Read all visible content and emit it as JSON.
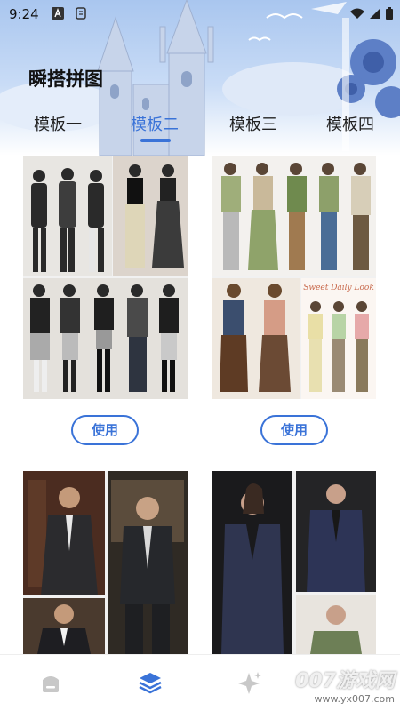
{
  "status_bar": {
    "time": "9:24",
    "icons": [
      "a-badge-icon",
      "app-icon",
      "wifi-icon",
      "signal-icon",
      "battery-icon"
    ]
  },
  "header": {
    "title": "瞬搭拼图"
  },
  "tabs": [
    {
      "label": "模板一",
      "active": false
    },
    {
      "label": "模板二",
      "active": true
    },
    {
      "label": "模板三",
      "active": false
    },
    {
      "label": "模板四",
      "active": false
    }
  ],
  "templates": [
    {
      "name": "street-style",
      "button": "使用"
    },
    {
      "name": "casual-collection",
      "button": "使用",
      "caption": "Sweet Daily Look"
    },
    {
      "name": "menswear-suits",
      "button": ""
    },
    {
      "name": "womens-blazers",
      "button": ""
    }
  ],
  "bottom_nav": [
    {
      "icon": "home-icon",
      "active": false
    },
    {
      "icon": "layers-icon",
      "active": true
    },
    {
      "icon": "sparkle-icon",
      "active": false
    }
  ],
  "watermark": {
    "line1": "007游戏网",
    "line2": "www.yx007.com"
  },
  "colors": {
    "accent": "#3a73d8",
    "sky": "#a9c6ef"
  }
}
